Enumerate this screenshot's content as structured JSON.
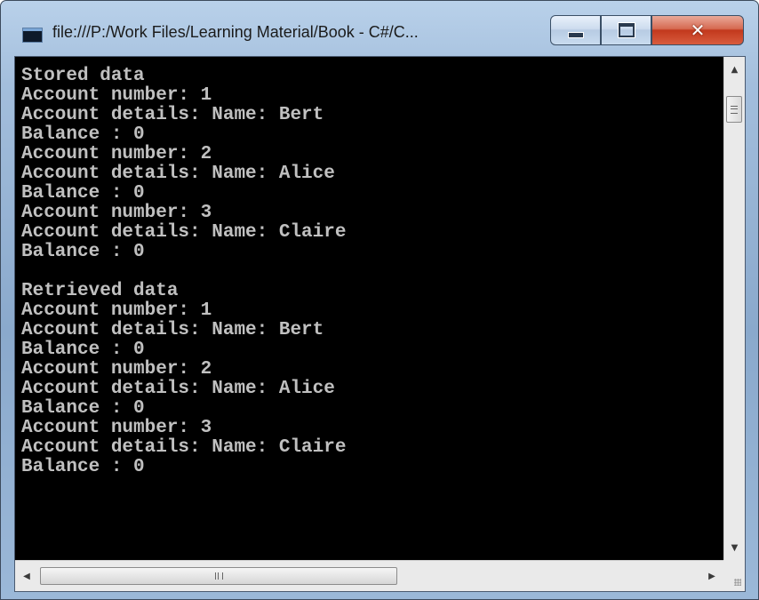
{
  "window": {
    "title": "file:///P:/Work Files/Learning Material/Book - C#/C...",
    "icon": "console-app-icon",
    "controls": {
      "minimize": "minimize-icon",
      "maximize": "maximize-icon",
      "close": "close-icon",
      "close_color": "#c2391d"
    }
  },
  "console": {
    "background": "#000000",
    "foreground": "#c0c0c0",
    "lines": [
      "Stored data",
      "Account number: 1",
      "Account details: Name: Bert",
      "Balance : 0",
      "Account number: 2",
      "Account details: Name: Alice",
      "Balance : 0",
      "Account number: 3",
      "Account details: Name: Claire",
      "Balance : 0",
      "",
      "Retrieved data",
      "Account number: 1",
      "Account details: Name: Bert",
      "Balance : 0",
      "Account number: 2",
      "Account details: Name: Alice",
      "Balance : 0",
      "Account number: 3",
      "Account details: Name: Claire",
      "Balance : 0"
    ]
  },
  "scrollbars": {
    "vertical": {
      "up_icon": "up-arrow-icon",
      "down_icon": "down-arrow-icon"
    },
    "horizontal": {
      "left_icon": "left-arrow-icon",
      "right_icon": "right-arrow-icon"
    }
  }
}
